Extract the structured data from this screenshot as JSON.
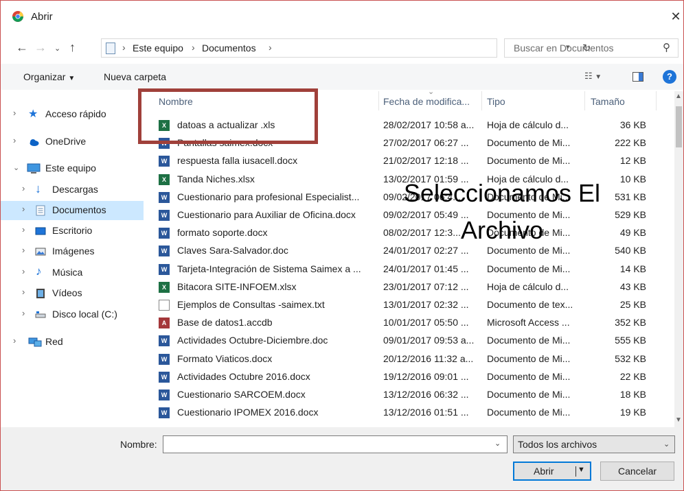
{
  "window": {
    "title": "Abrir"
  },
  "address": {
    "crumbs": [
      "Este equipo",
      "Documentos"
    ],
    "search_placeholder": "Buscar en Documentos"
  },
  "toolbar": {
    "organize": "Organizar",
    "new_folder": "Nueva carpeta"
  },
  "sidebar": {
    "items": [
      {
        "label": "Acceso rápido",
        "icon": "star-icon"
      },
      {
        "label": "OneDrive",
        "icon": "cloud-icon"
      },
      {
        "label": "Este equipo",
        "icon": "computer-icon"
      },
      {
        "label": "Descargas",
        "icon": "download-icon"
      },
      {
        "label": "Documentos",
        "icon": "document-folder-icon"
      },
      {
        "label": "Escritorio",
        "icon": "desktop-icon"
      },
      {
        "label": "Imágenes",
        "icon": "pictures-icon"
      },
      {
        "label": "Música",
        "icon": "music-icon"
      },
      {
        "label": "Vídeos",
        "icon": "video-icon"
      },
      {
        "label": "Disco local (C:)",
        "icon": "disk-icon"
      },
      {
        "label": "Red",
        "icon": "network-icon"
      }
    ]
  },
  "columns": {
    "name": "Nombre",
    "date": "Fecha de modifica...",
    "type": "Tipo",
    "size": "Tamaño"
  },
  "files": [
    {
      "name": "datoas a actualizar .xls",
      "date": "28/02/2017 10:58 a...",
      "type": "Hoja de cálculo d...",
      "size": "36 KB",
      "kind": "xls"
    },
    {
      "name": "Pantallas saimex.docx",
      "date": "27/02/2017 06:27 ...",
      "type": "Documento de Mi...",
      "size": "222 KB",
      "kind": "doc"
    },
    {
      "name": "respuesta falla iusacell.docx",
      "date": "21/02/2017 12:18 ...",
      "type": "Documento de Mi...",
      "size": "12 KB",
      "kind": "doc"
    },
    {
      "name": "Tanda Niches.xlsx",
      "date": "13/02/2017 01:59 ...",
      "type": "Hoja de cálculo d...",
      "size": "10 KB",
      "kind": "xls"
    },
    {
      "name": "Cuestionario para profesional Especialist...",
      "date": "09/02/2017 06:4...",
      "type": "Documento de Mi...",
      "size": "531 KB",
      "kind": "doc"
    },
    {
      "name": "Cuestionario para Auxiliar de Oficina.docx",
      "date": "09/02/2017 05:49 ...",
      "type": "Documento de Mi...",
      "size": "529 KB",
      "kind": "doc"
    },
    {
      "name": "formato soporte.docx",
      "date": "08/02/2017 12:3...",
      "type": "Documento de Mi...",
      "size": "49 KB",
      "kind": "doc"
    },
    {
      "name": "Claves Sara-Salvador.doc",
      "date": "24/01/2017 02:27 ...",
      "type": "Documento de Mi...",
      "size": "540 KB",
      "kind": "doc"
    },
    {
      "name": "Tarjeta-Integración de Sistema Saimex a ...",
      "date": "24/01/2017 01:45 ...",
      "type": "Documento de Mi...",
      "size": "14 KB",
      "kind": "doc"
    },
    {
      "name": "Bitacora SITE-INFOEM.xlsx",
      "date": "23/01/2017 07:12 ...",
      "type": "Hoja de cálculo d...",
      "size": "43 KB",
      "kind": "xls"
    },
    {
      "name": "Ejemplos de Consultas -saimex.txt",
      "date": "13/01/2017 02:32 ...",
      "type": "Documento de tex...",
      "size": "25 KB",
      "kind": "txt"
    },
    {
      "name": "Base de datos1.accdb",
      "date": "10/01/2017 05:50 ...",
      "type": "Microsoft Access ...",
      "size": "352 KB",
      "kind": "acc"
    },
    {
      "name": "Actividades Octubre-Diciembre.doc",
      "date": "09/01/2017 09:53 a...",
      "type": "Documento de Mi...",
      "size": "555 KB",
      "kind": "doc"
    },
    {
      "name": "Formato Viaticos.docx",
      "date": "20/12/2016 11:32 a...",
      "type": "Documento de Mi...",
      "size": "532 KB",
      "kind": "doc"
    },
    {
      "name": "Actividades Octubre 2016.docx",
      "date": "19/12/2016 09:01 ...",
      "type": "Documento de Mi...",
      "size": "22 KB",
      "kind": "doc"
    },
    {
      "name": "Cuestionario SARCOEM.docx",
      "date": "13/12/2016 06:32 ...",
      "type": "Documento de Mi...",
      "size": "18 KB",
      "kind": "doc"
    },
    {
      "name": "Cuestionario IPOMEX 2016.docx",
      "date": "13/12/2016 01:51 ...",
      "type": "Documento de Mi...",
      "size": "19 KB",
      "kind": "doc"
    }
  ],
  "footer": {
    "name_label": "Nombre:",
    "name_value": "",
    "filter": "Todos los archivos",
    "open": "Abrir",
    "cancel": "Cancelar"
  },
  "overlay": {
    "caption_line1": "Seleccionamos El",
    "caption_line2": "Archivo"
  },
  "colors": {
    "highlight": "#a0403a",
    "selected": "#cce8ff",
    "accent": "#0078d7"
  }
}
